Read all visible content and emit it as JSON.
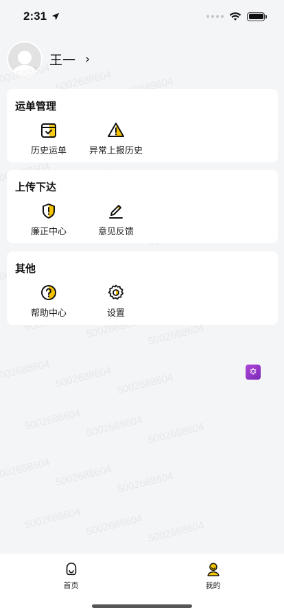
{
  "status_bar": {
    "time": "2:31"
  },
  "profile": {
    "name": "王一",
    "chevron": "›"
  },
  "sections": [
    {
      "title": "运单管理",
      "items": [
        {
          "label": "历史运单",
          "icon": "calendar-check-icon"
        },
        {
          "label": "异常上报历史",
          "icon": "warning-triangle-icon"
        }
      ]
    },
    {
      "title": "上传下达",
      "items": [
        {
          "label": "廉正中心",
          "icon": "shield-alert-icon"
        },
        {
          "label": "意见反馈",
          "icon": "pencil-icon"
        }
      ]
    },
    {
      "title": "其他",
      "items": [
        {
          "label": "帮助中心",
          "icon": "help-circle-icon"
        },
        {
          "label": "设置",
          "icon": "gear-icon"
        }
      ]
    }
  ],
  "watermark_text": "5002688604",
  "tabs": [
    {
      "label": "首页",
      "icon": "home-face-icon",
      "active": false
    },
    {
      "label": "我的",
      "icon": "user-icon",
      "active": true
    }
  ],
  "colors": {
    "accent": "#f5c400",
    "background": "#f4f5f7",
    "card": "#ffffff"
  }
}
